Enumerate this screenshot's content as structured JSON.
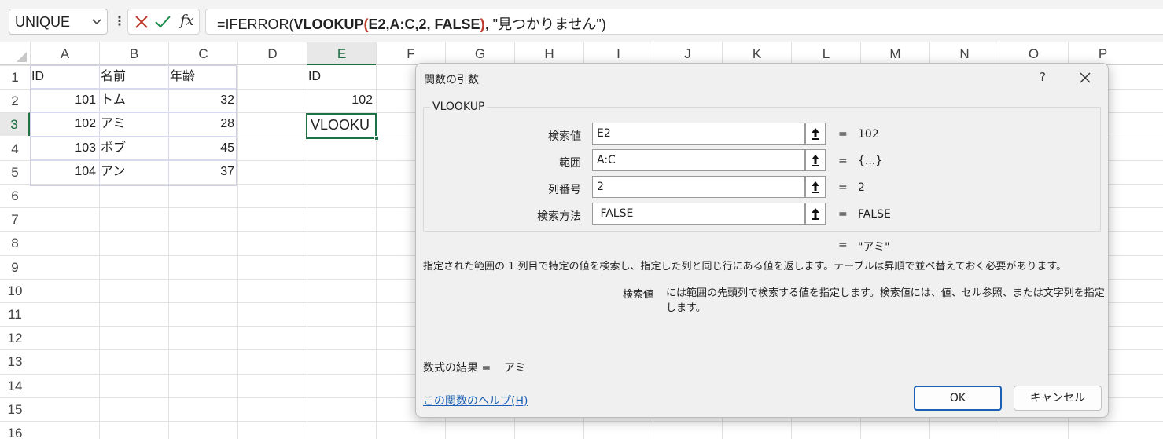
{
  "namebox": {
    "value": "UNIQUE"
  },
  "formula_bar": {
    "fx_label": "fx",
    "parts": [
      {
        "text": "=IFERROR(",
        "style": "normal"
      },
      {
        "text": "VLOOKUP",
        "style": "bold"
      },
      {
        "text": "(",
        "style": "red"
      },
      {
        "text": "E2,A:C,2, FALSE",
        "style": "bold"
      },
      {
        "text": ")",
        "style": "red"
      },
      {
        "text": ", \"見つかりません\")",
        "style": "normal"
      }
    ]
  },
  "grid": {
    "columns": [
      "A",
      "B",
      "C",
      "D",
      "E",
      "F",
      "G",
      "H",
      "I",
      "J",
      "K",
      "L",
      "M",
      "N",
      "O",
      "P"
    ],
    "rows": [
      "1",
      "2",
      "3",
      "4",
      "5",
      "6",
      "7",
      "8",
      "9",
      "10",
      "11",
      "12",
      "13",
      "14",
      "15",
      "16"
    ],
    "selected_column": "E",
    "selected_row": "3",
    "cells": {
      "A1": "ID",
      "B1": "名前",
      "C1": "年齢",
      "A2": "101",
      "B2": "トム",
      "C2": "32",
      "A3": "102",
      "B3": "アミ",
      "C3": "28",
      "A4": "103",
      "B4": "ボブ",
      "C4": "45",
      "A5": "104",
      "B5": "アン",
      "C5": "37",
      "E1": "ID",
      "E2": "102"
    },
    "active_cell": {
      "ref": "E3",
      "value": "VLOOKU"
    }
  },
  "dialog": {
    "title": "関数の引数",
    "help_label": "?",
    "function_name": "VLOOKUP",
    "args": [
      {
        "label": "検索値",
        "value": "E2",
        "result": "102"
      },
      {
        "label": "範囲",
        "value": "A:C",
        "result": "{...}"
      },
      {
        "label": "列番号",
        "value": "2",
        "result": "2"
      },
      {
        "label": "検索方法",
        "value": " FALSE",
        "result": "FALSE"
      }
    ],
    "equals": "=",
    "result_preview": "\"アミ\"",
    "description": "指定された範囲の 1 列目で特定の値を検索し、指定した列と同じ行にある値を返します。テーブルは昇順で並べ替えておく必要があります。",
    "arg_description_label": "検索値",
    "arg_description": "には範囲の先頭列で検索する値を指定します。検索値には、値、セル参照、または文字列を指定します。",
    "formula_result_label": "数式の結果 =",
    "formula_result_value": "アミ",
    "help_link": "この関数のヘルプ(H)",
    "ok_label": "OK",
    "cancel_label": "キャンセル"
  },
  "colors": {
    "excel_green": "#1e7145",
    "link_blue": "#1a5fb4",
    "cancel_red": "#c0392b",
    "enter_green": "#1e8c4c"
  }
}
